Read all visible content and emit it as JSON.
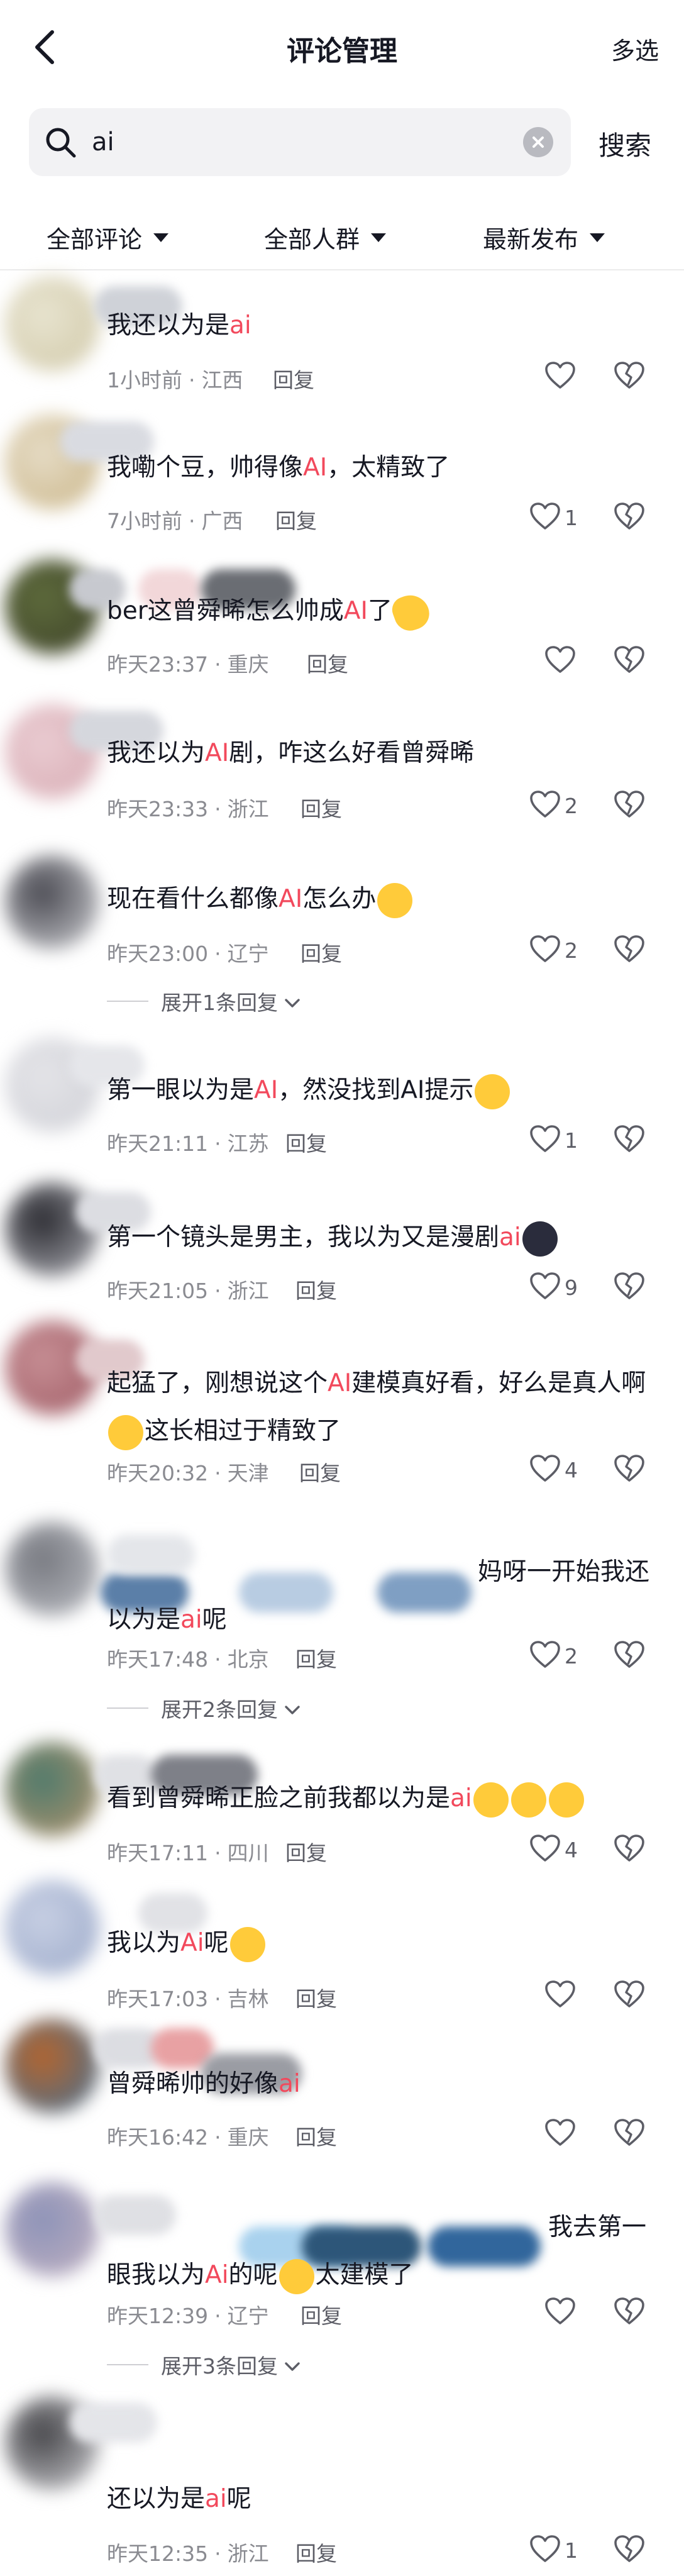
{
  "header": {
    "title": "评论管理",
    "multi_select": "多选"
  },
  "search": {
    "value": "ai",
    "button": "搜索"
  },
  "filters": [
    {
      "label": "全部评论"
    },
    {
      "label": "全部人群"
    },
    {
      "label": "最新发布"
    }
  ],
  "reply_label": "回复",
  "comments": [
    {
      "segments": [
        {
          "t": "我还以为是"
        },
        {
          "t": "ai",
          "hl": true
        }
      ],
      "time": "1小时前",
      "region": "江西",
      "likes": ""
    },
    {
      "segments": [
        {
          "t": "我嘞个豆，帅得像"
        },
        {
          "t": "AI",
          "hl": true
        },
        {
          "t": "，太精致了"
        }
      ],
      "time": "7小时前",
      "region": "广西",
      "likes": "1"
    },
    {
      "segments": [
        {
          "t": "ber这曾舜晞怎么帅成"
        },
        {
          "t": "AI",
          "hl": true
        },
        {
          "t": "了"
        }
      ],
      "emoji_after": "tilted",
      "time": "昨天23:37",
      "region": "重庆",
      "likes": ""
    },
    {
      "segments": [
        {
          "t": "我还以为"
        },
        {
          "t": "AI",
          "hl": true
        },
        {
          "t": "剧，咋这么好看曾舜晞"
        }
      ],
      "time": "昨天23:33",
      "region": "浙江",
      "likes": "2"
    },
    {
      "segments": [
        {
          "t": "现在看什么都像"
        },
        {
          "t": "AI",
          "hl": true
        },
        {
          "t": "怎么办"
        }
      ],
      "time": "昨天23:00",
      "region": "辽宁",
      "likes": "2",
      "expand": "展开1条回复"
    },
    {
      "segments": [
        {
          "t": "第一眼以为是"
        },
        {
          "t": "AI",
          "hl": true
        },
        {
          "t": "，然没找到AI提示"
        }
      ],
      "time": "昨天21:11",
      "region": "江苏",
      "likes": "1"
    },
    {
      "segments": [
        {
          "t": "第一个镜头是男主，我以为又是漫剧"
        },
        {
          "t": "ai",
          "hl": true
        }
      ],
      "time": "昨天21:05",
      "region": "浙江",
      "likes": "9"
    },
    {
      "segments": [
        {
          "t": "起猛了，刚想说这个"
        },
        {
          "t": "AI",
          "hl": true
        },
        {
          "t": "建模真好看，好么是真人啊"
        }
      ],
      "line2": "这长相过于精致了",
      "time": "昨天20:32",
      "region": "天津",
      "likes": "4"
    },
    {
      "segments": [
        {
          "t": "妈呀一开始我还"
        }
      ],
      "line2_segments": [
        {
          "t": "以为是"
        },
        {
          "t": "ai",
          "hl": true
        },
        {
          "t": "呢"
        }
      ],
      "time": "昨天17:48",
      "region": "北京",
      "likes": "2",
      "expand": "展开2条回复"
    },
    {
      "segments": [
        {
          "t": "看到曾舜晞正脸之前我都以为是"
        },
        {
          "t": "ai",
          "hl": true
        }
      ],
      "time": "昨天17:11",
      "region": "四川",
      "likes": "4"
    },
    {
      "segments": [
        {
          "t": "我以为"
        },
        {
          "t": "Ai",
          "hl": true
        },
        {
          "t": "呢"
        }
      ],
      "time": "昨天17:03",
      "region": "吉林",
      "likes": ""
    },
    {
      "segments": [
        {
          "t": "曾舜晞帅的好像"
        },
        {
          "t": "ai",
          "hl": true
        }
      ],
      "time": "昨天16:42",
      "region": "重庆",
      "likes": ""
    },
    {
      "segments": [
        {
          "t": "我去第一"
        }
      ],
      "line2_segments": [
        {
          "t": "眼我以为"
        },
        {
          "t": "Ai",
          "hl": true
        },
        {
          "t": "的呢"
        }
      ],
      "line2_tail": "太建模了",
      "time": "昨天12:39",
      "region": "辽宁",
      "likes": "",
      "expand": "展开3条回复"
    },
    {
      "segments": [
        {
          "t": "还以为是"
        },
        {
          "t": "ai",
          "hl": true
        },
        {
          "t": "呢"
        }
      ],
      "time": "昨天12:35",
      "region": "浙江",
      "likes": "1"
    }
  ],
  "colors": {
    "highlight": "#f2495c",
    "meta": "#8a8b91",
    "text": "#161823"
  }
}
